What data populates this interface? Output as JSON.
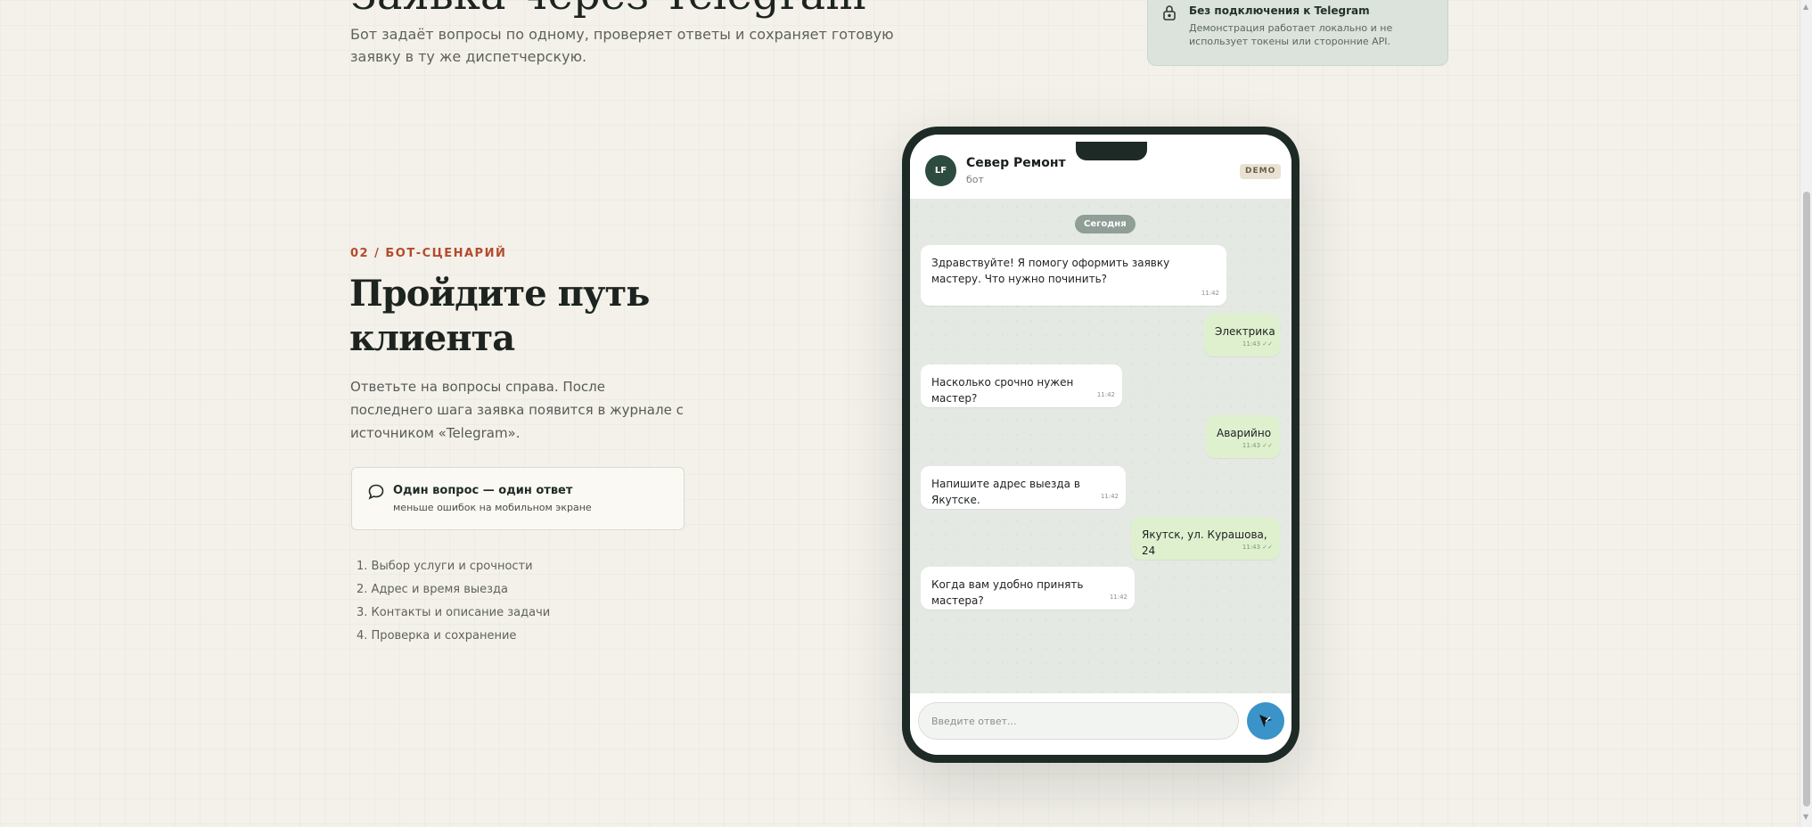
{
  "top_section": {
    "heading": "Заявка через Telegram",
    "subtitle": "Бот задаёт вопросы по одному, проверяет ответы и сохраняет готовую заявку в ту же диспетчерскую.",
    "notice": {
      "icon": "lock-icon",
      "title": "Без подключения к Telegram",
      "text": "Демонстрация работает локально и не использует токены или сторонние API."
    }
  },
  "section": {
    "kicker": "02 / БОТ-СЦЕНАРИЙ",
    "title": "Пройдите путь клиента",
    "lead": "Ответьте на вопросы справа. После последнего шага заявка появится в журнале с источником «Telegram».",
    "feature": {
      "icon": "chat-bubble-icon",
      "title": "Один вопрос — один ответ",
      "subtitle": "меньше ошибок на мобильном экране"
    },
    "steps": [
      "1. Выбор услуги и срочности",
      "2. Адрес и время выезда",
      "3. Контакты и описание задачи",
      "4. Проверка и сохранение"
    ]
  },
  "chat": {
    "avatar_initials": "LF",
    "name": "Север Ремонт",
    "status": "бот",
    "badge": "DEMO",
    "day_label": "Сегодня",
    "messages": [
      {
        "from": "bot",
        "text": "Здравствуйте! Я помогу оформить заявку мастеру. Что нужно починить?",
        "time": "11:42"
      },
      {
        "from": "user",
        "text": "Электрика",
        "time": "11:43 ✓✓"
      },
      {
        "from": "bot",
        "text": "Насколько срочно нужен мастер?",
        "time": "11:42"
      },
      {
        "from": "user",
        "text": "Аварийно",
        "time": "11:43 ✓✓"
      },
      {
        "from": "bot",
        "text": "Напишите адрес выезда в Якутске.",
        "time": "11:42"
      },
      {
        "from": "user",
        "text": "Якутск, ул. Курашова, 24",
        "time": "11:43 ✓✓"
      },
      {
        "from": "bot",
        "text": "Когда вам удобно принять мастера?",
        "time": "11:42"
      }
    ],
    "input_placeholder": "Введите ответ...",
    "send_icon": "send-icon"
  },
  "colors": {
    "accent": "#b44a2c",
    "brand_dark": "#2d4b3f",
    "send_button": "#3a93c9",
    "user_bubble": "#dff0cf",
    "notice_bg": "#dbe3dc"
  }
}
